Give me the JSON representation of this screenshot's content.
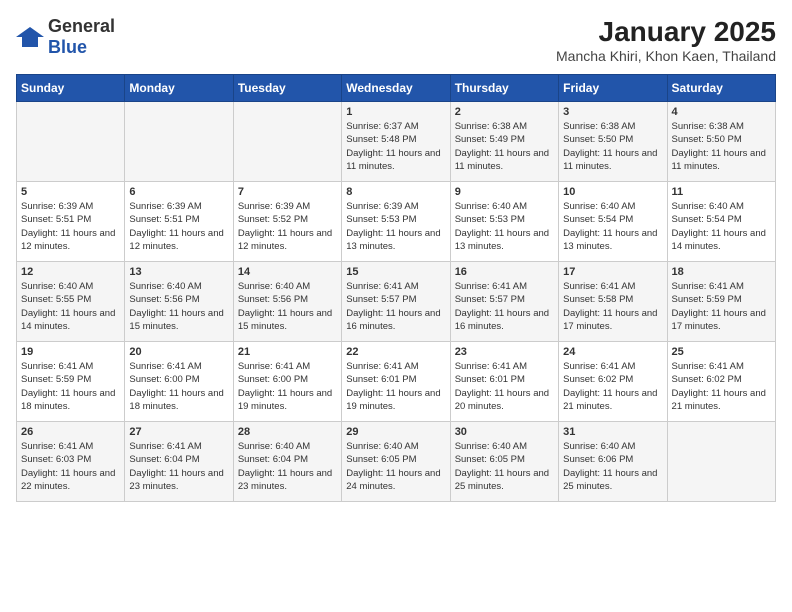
{
  "header": {
    "logo_general": "General",
    "logo_blue": "Blue",
    "title": "January 2025",
    "subtitle": "Mancha Khiri, Khon Kaen, Thailand"
  },
  "weekdays": [
    "Sunday",
    "Monday",
    "Tuesday",
    "Wednesday",
    "Thursday",
    "Friday",
    "Saturday"
  ],
  "weeks": [
    [
      {
        "day": "",
        "info": ""
      },
      {
        "day": "",
        "info": ""
      },
      {
        "day": "",
        "info": ""
      },
      {
        "day": "1",
        "info": "Sunrise: 6:37 AM\nSunset: 5:48 PM\nDaylight: 11 hours and 11 minutes."
      },
      {
        "day": "2",
        "info": "Sunrise: 6:38 AM\nSunset: 5:49 PM\nDaylight: 11 hours and 11 minutes."
      },
      {
        "day": "3",
        "info": "Sunrise: 6:38 AM\nSunset: 5:50 PM\nDaylight: 11 hours and 11 minutes."
      },
      {
        "day": "4",
        "info": "Sunrise: 6:38 AM\nSunset: 5:50 PM\nDaylight: 11 hours and 11 minutes."
      }
    ],
    [
      {
        "day": "5",
        "info": "Sunrise: 6:39 AM\nSunset: 5:51 PM\nDaylight: 11 hours and 12 minutes."
      },
      {
        "day": "6",
        "info": "Sunrise: 6:39 AM\nSunset: 5:51 PM\nDaylight: 11 hours and 12 minutes."
      },
      {
        "day": "7",
        "info": "Sunrise: 6:39 AM\nSunset: 5:52 PM\nDaylight: 11 hours and 12 minutes."
      },
      {
        "day": "8",
        "info": "Sunrise: 6:39 AM\nSunset: 5:53 PM\nDaylight: 11 hours and 13 minutes."
      },
      {
        "day": "9",
        "info": "Sunrise: 6:40 AM\nSunset: 5:53 PM\nDaylight: 11 hours and 13 minutes."
      },
      {
        "day": "10",
        "info": "Sunrise: 6:40 AM\nSunset: 5:54 PM\nDaylight: 11 hours and 13 minutes."
      },
      {
        "day": "11",
        "info": "Sunrise: 6:40 AM\nSunset: 5:54 PM\nDaylight: 11 hours and 14 minutes."
      }
    ],
    [
      {
        "day": "12",
        "info": "Sunrise: 6:40 AM\nSunset: 5:55 PM\nDaylight: 11 hours and 14 minutes."
      },
      {
        "day": "13",
        "info": "Sunrise: 6:40 AM\nSunset: 5:56 PM\nDaylight: 11 hours and 15 minutes."
      },
      {
        "day": "14",
        "info": "Sunrise: 6:40 AM\nSunset: 5:56 PM\nDaylight: 11 hours and 15 minutes."
      },
      {
        "day": "15",
        "info": "Sunrise: 6:41 AM\nSunset: 5:57 PM\nDaylight: 11 hours and 16 minutes."
      },
      {
        "day": "16",
        "info": "Sunrise: 6:41 AM\nSunset: 5:57 PM\nDaylight: 11 hours and 16 minutes."
      },
      {
        "day": "17",
        "info": "Sunrise: 6:41 AM\nSunset: 5:58 PM\nDaylight: 11 hours and 17 minutes."
      },
      {
        "day": "18",
        "info": "Sunrise: 6:41 AM\nSunset: 5:59 PM\nDaylight: 11 hours and 17 minutes."
      }
    ],
    [
      {
        "day": "19",
        "info": "Sunrise: 6:41 AM\nSunset: 5:59 PM\nDaylight: 11 hours and 18 minutes."
      },
      {
        "day": "20",
        "info": "Sunrise: 6:41 AM\nSunset: 6:00 PM\nDaylight: 11 hours and 18 minutes."
      },
      {
        "day": "21",
        "info": "Sunrise: 6:41 AM\nSunset: 6:00 PM\nDaylight: 11 hours and 19 minutes."
      },
      {
        "day": "22",
        "info": "Sunrise: 6:41 AM\nSunset: 6:01 PM\nDaylight: 11 hours and 19 minutes."
      },
      {
        "day": "23",
        "info": "Sunrise: 6:41 AM\nSunset: 6:01 PM\nDaylight: 11 hours and 20 minutes."
      },
      {
        "day": "24",
        "info": "Sunrise: 6:41 AM\nSunset: 6:02 PM\nDaylight: 11 hours and 21 minutes."
      },
      {
        "day": "25",
        "info": "Sunrise: 6:41 AM\nSunset: 6:02 PM\nDaylight: 11 hours and 21 minutes."
      }
    ],
    [
      {
        "day": "26",
        "info": "Sunrise: 6:41 AM\nSunset: 6:03 PM\nDaylight: 11 hours and 22 minutes."
      },
      {
        "day": "27",
        "info": "Sunrise: 6:41 AM\nSunset: 6:04 PM\nDaylight: 11 hours and 23 minutes."
      },
      {
        "day": "28",
        "info": "Sunrise: 6:40 AM\nSunset: 6:04 PM\nDaylight: 11 hours and 23 minutes."
      },
      {
        "day": "29",
        "info": "Sunrise: 6:40 AM\nSunset: 6:05 PM\nDaylight: 11 hours and 24 minutes."
      },
      {
        "day": "30",
        "info": "Sunrise: 6:40 AM\nSunset: 6:05 PM\nDaylight: 11 hours and 25 minutes."
      },
      {
        "day": "31",
        "info": "Sunrise: 6:40 AM\nSunset: 6:06 PM\nDaylight: 11 hours and 25 minutes."
      },
      {
        "day": "",
        "info": ""
      }
    ]
  ]
}
